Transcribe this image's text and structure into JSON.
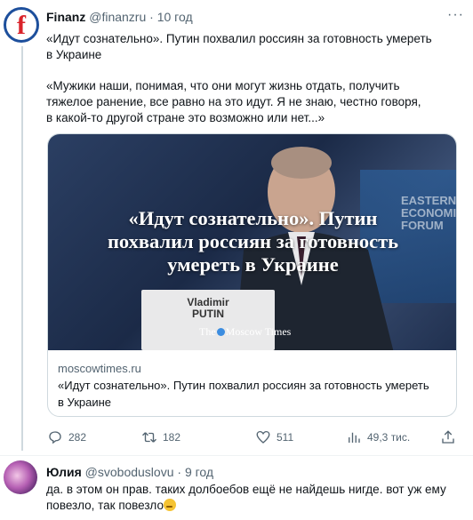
{
  "tweet": {
    "author_name": "Finanz",
    "author_handle": "@finanzru",
    "separator": "·",
    "time": "10 год",
    "more_icon": "more-icon",
    "text_line1": "«Идут сознательно». Путин похвалил россиян за готовность умереть",
    "text_line2": "в Украине",
    "quote_line1": "«Мужики наши, понимая, что они могут жизнь отдать, получить",
    "quote_line2": "тяжелое ранение, все равно на это идут. Я не знаю, честно говоря,",
    "quote_line3": "в какой-то другой стране это возможно или нет...»",
    "card": {
      "headline_line1": "«Идут сознательно». Путин",
      "headline_line2": "похвалил россиян за готовность",
      "headline_line3": "умереть в Украине",
      "logo": "The Moscow Times",
      "logo_pre": "The",
      "logo_post": "Moscow Times",
      "plate_line1": "Vladimir",
      "plate_line2": "PUTIN",
      "banner_text": "EASTERN ECONOMIC FORUM",
      "domain": "moscowtimes.ru",
      "title_line1": "«Идут сознательно». Путин похвалил россиян за готовность умереть",
      "title_line2": "в Украине"
    },
    "actions": {
      "replies": "282",
      "retweets": "182",
      "likes": "511",
      "views": "49,3 тис."
    }
  },
  "reply": {
    "author_name": "Юлия",
    "author_handle": "@svoboduslovu",
    "separator": "·",
    "time": "9 год",
    "text_line1": "да. в этом он прав. таких долбоебов ещё не найдешь нигде. вот уж ему",
    "text_line2": "повезло, так повезло"
  },
  "colors": {
    "accent": "#1d9bf0",
    "secondary_text": "#536471",
    "border": "#cfd9de"
  }
}
